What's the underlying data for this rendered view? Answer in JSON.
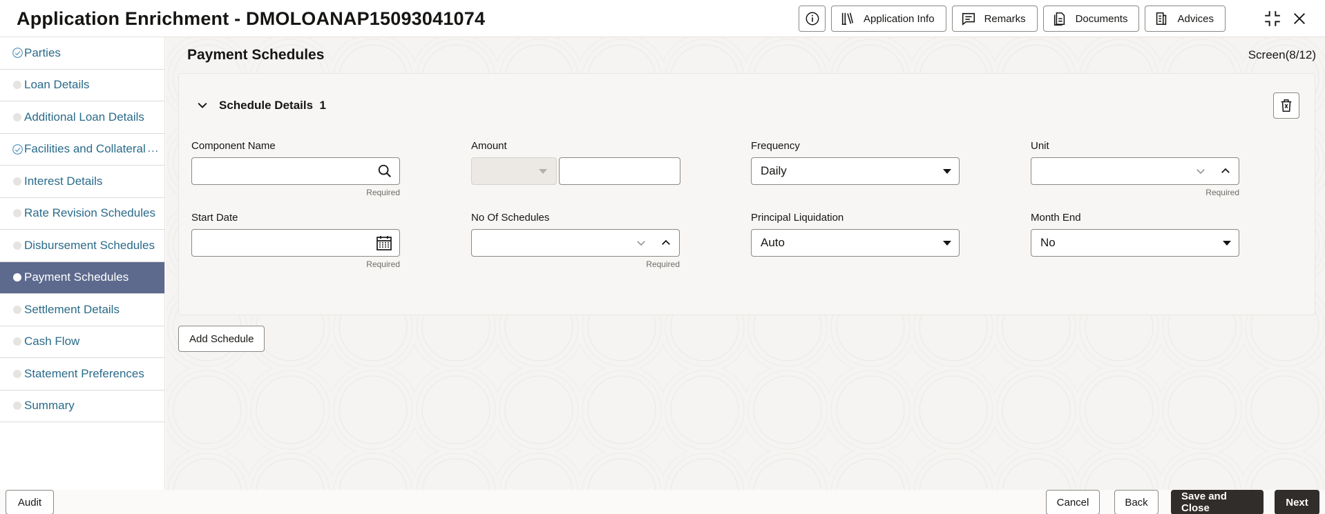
{
  "header": {
    "title": "Application Enrichment - DMOLOANAP15093041074",
    "buttons": [
      "Application Info",
      "Remarks",
      "Documents",
      "Advices"
    ],
    "icons": [
      "info-icon",
      "expand-icon",
      "close-icon"
    ]
  },
  "sidebar": {
    "items": [
      {
        "label": "Parties",
        "state": "completed"
      },
      {
        "label": "Loan Details",
        "state": "pending"
      },
      {
        "label": "Additional Loan Details",
        "state": "pending"
      },
      {
        "label": "Facilities and Collateral",
        "state": "completed"
      },
      {
        "label": "Interest Details",
        "state": "pending"
      },
      {
        "label": "Rate Revision Schedules",
        "state": "pending"
      },
      {
        "label": "Disbursement Schedules",
        "state": "pending"
      },
      {
        "label": "Payment Schedules",
        "state": "active"
      },
      {
        "label": "Settlement Details",
        "state": "pending"
      },
      {
        "label": "Cash Flow",
        "state": "pending"
      },
      {
        "label": "Statement Preferences",
        "state": "pending"
      },
      {
        "label": "Summary",
        "state": "pending"
      }
    ],
    "more_label": "..."
  },
  "main": {
    "page_title": "Payment Schedules",
    "screen_count": "Screen(8/12)",
    "card": {
      "title": "Schedule Details",
      "index": "1",
      "fields": {
        "component_name": {
          "label": "Component Name",
          "value": "",
          "hint": "Required"
        },
        "amount": {
          "label": "Amount",
          "currency": "",
          "value": ""
        },
        "frequency": {
          "label": "Frequency",
          "value": "Daily"
        },
        "unit": {
          "label": "Unit",
          "value": "",
          "hint": "Required"
        },
        "start_date": {
          "label": "Start Date",
          "value": "",
          "hint": "Required"
        },
        "no_of_schedules": {
          "label": "No Of Schedules",
          "value": "",
          "hint": "Required"
        },
        "principal_liquidation": {
          "label": "Principal Liquidation",
          "value": "Auto"
        },
        "month_end": {
          "label": "Month End",
          "value": "No"
        }
      }
    },
    "add_schedule_label": "Add Schedule"
  },
  "footer": {
    "audit": "Audit",
    "cancel": "Cancel",
    "back": "Back",
    "save_close": "Save and Close",
    "next": "Next"
  }
}
